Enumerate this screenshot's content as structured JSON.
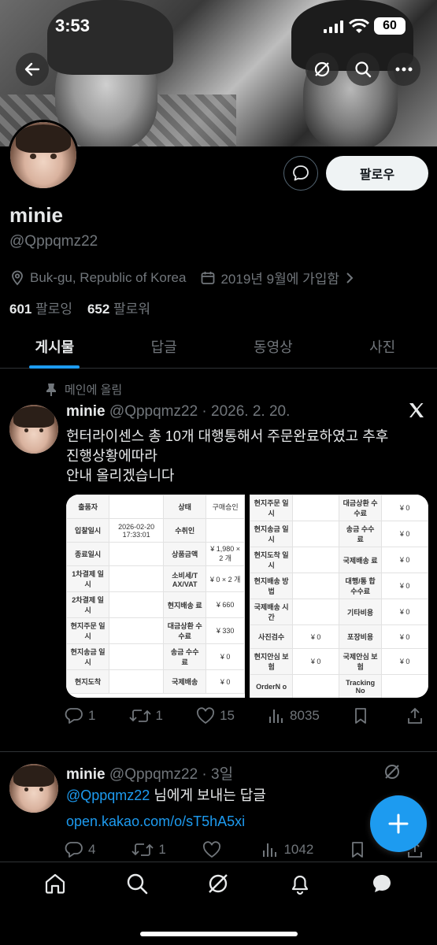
{
  "status_bar": {
    "time": "3:53",
    "battery": "60"
  },
  "profile": {
    "name": "minie",
    "handle": "@Qppqmz22",
    "location": "Buk-gu, Republic of Korea",
    "joined": "2019년 9월에 가입함",
    "following_count": "601",
    "following_label": "팔로잉",
    "followers_count": "652",
    "followers_label": "팔로워",
    "follow_button": "팔로우"
  },
  "tabs": [
    {
      "label": "게시물",
      "active": true
    },
    {
      "label": "답글",
      "active": false
    },
    {
      "label": "동영상",
      "active": false
    },
    {
      "label": "사진",
      "active": false
    }
  ],
  "posts": [
    {
      "pinned_label": "메인에 올림",
      "author": "minie",
      "handle": "@Qppqmz22",
      "date": "· 2026. 2. 20.",
      "text_line1": "헌터라이센스 총 10개 대행통해서 주문완료하였고 추후",
      "text_line2": "진행상황에따라",
      "text_line3": "안내 올리겠습니다",
      "media_left": [
        [
          "출품자",
          "",
          "상태",
          "구매승인"
        ],
        [
          "입찰일시",
          "2026-02-20 17:33:01",
          "수취인",
          ""
        ],
        [
          "종료일시",
          "",
          "상품금액",
          "¥ 1,980 × 2 개"
        ],
        [
          "1차결제 일시",
          "",
          "소비세/T AX/VAT",
          "¥ 0 × 2 개"
        ],
        [
          "2차결제 일시",
          "",
          "현지배송 료",
          "¥ 660"
        ],
        [
          "현지주문 일시",
          "",
          "대금상환 수수료",
          "¥ 330"
        ],
        [
          "현지송금 일시",
          "",
          "송금 수수 료",
          "¥ 0"
        ],
        [
          "현지도착",
          "",
          "국제배송",
          "¥ 0"
        ]
      ],
      "media_right": [
        [
          "현지주문 일시",
          "",
          "대금상환 수수료",
          "¥ 0"
        ],
        [
          "현지송금 일시",
          "",
          "송금 수수 료",
          "¥ 0"
        ],
        [
          "현지도착 일시",
          "",
          "국제배송 료",
          "¥ 0"
        ],
        [
          "현지배송 방법",
          "",
          "대행/통 합 수수료",
          "¥ 0"
        ],
        [
          "국제배송 시간",
          "",
          "기타비용",
          "¥ 0"
        ],
        [
          "사진검수",
          "¥ 0",
          "포장비용",
          "¥ 0"
        ],
        [
          "현지안심 보험",
          "¥ 0",
          "국제안심 보험",
          "¥ 0"
        ],
        [
          "OrderN o",
          "",
          "Tracking No",
          ""
        ]
      ],
      "replies": "1",
      "reposts": "1",
      "likes": "15",
      "views": "8035"
    },
    {
      "author": "minie",
      "handle": "@Qppqmz22",
      "date": "· 3일",
      "mention": "@Qppqmz22",
      "mention_rest": " 님에게 보내는 답글",
      "link": "open.kakao.com/o/sT5hA5xi",
      "replies": "4",
      "reposts": "1",
      "likes": "",
      "views": "1042"
    }
  ],
  "colors": {
    "accent": "#1d9bf0",
    "background": "#000000",
    "muted": "#71767b"
  }
}
